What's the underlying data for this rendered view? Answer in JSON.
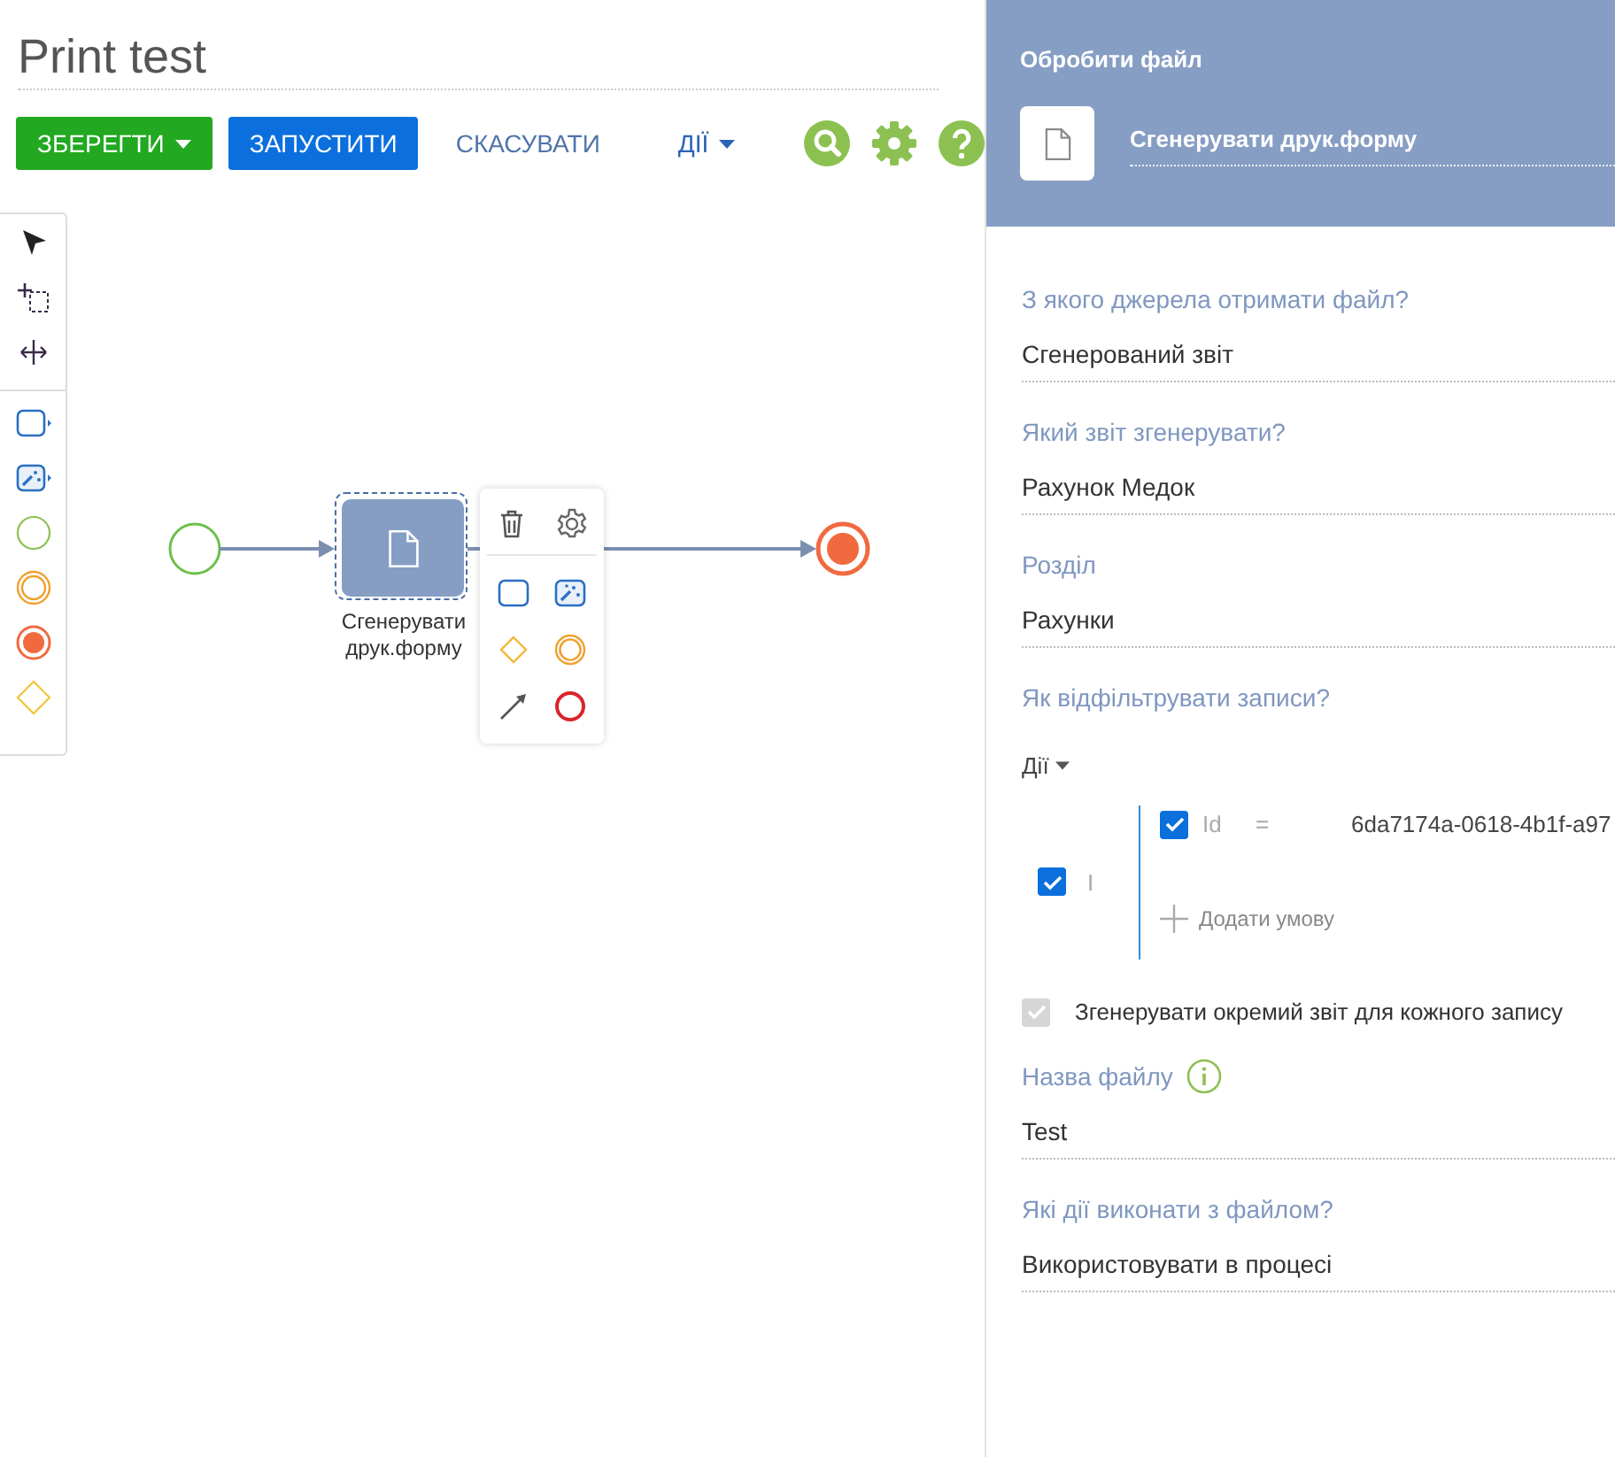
{
  "page": {
    "title": "Print test"
  },
  "toolbar": {
    "buttons": [
      {
        "label": "ЗБЕРЕГТИ",
        "kind": "save"
      },
      {
        "label": "ЗАПУСТИТИ",
        "kind": "run"
      },
      {
        "label": "СКАСУВАТИ",
        "kind": "link"
      },
      {
        "label": "ДІЇ",
        "kind": "menu"
      }
    ]
  },
  "diagram": {
    "task": {
      "label": "Сгенерувати друк.форму",
      "selected": true
    }
  },
  "panel": {
    "header": "Обробити файл",
    "element_name": "Сгенерувати друк.форму",
    "items": [
      {
        "kind": "field",
        "label": "З якого джерела отримати файл?",
        "value": "Сгенерований звіт"
      },
      {
        "kind": "field",
        "label": "Який звіт згенерувати?",
        "value": "Рахунок Медок"
      },
      {
        "kind": "field",
        "label": "Розділ",
        "value": "Рахунки"
      },
      {
        "kind": "filter",
        "label": "Як відфільтрувати записи?",
        "menu": "Дії",
        "group": {
          "checked": true,
          "operator": "І"
        },
        "conditions": [
          {
            "checked": true,
            "column": "Id",
            "operator": "=",
            "value": "6da7174a-0618-4b1f-a97"
          }
        ],
        "add_label": "Додати умову"
      },
      {
        "kind": "checkbox",
        "label": "Згенерувати окремий звіт для кожного запису",
        "checked": true,
        "disabled": true
      },
      {
        "kind": "field",
        "label": "Назва файлу",
        "info": true,
        "value": "Test"
      },
      {
        "kind": "field",
        "label": "Які дії виконати з файлом?",
        "value": "Використовувати в процесі"
      }
    ]
  }
}
